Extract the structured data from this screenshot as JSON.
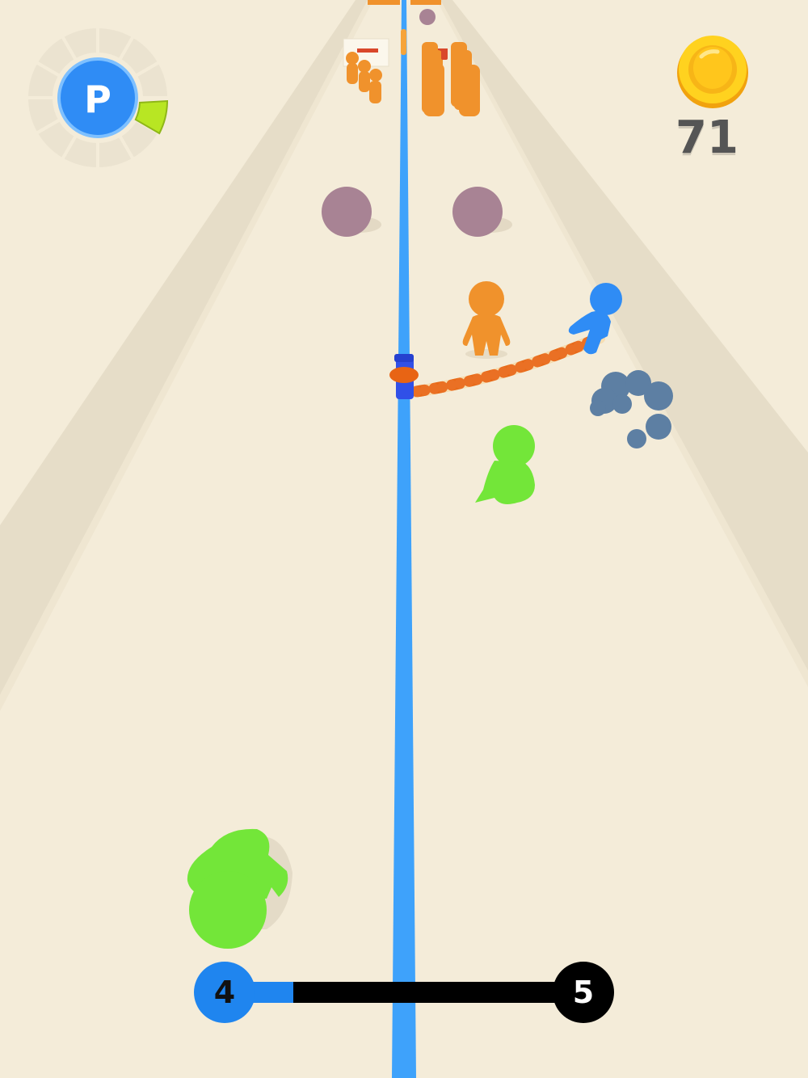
{
  "hud": {
    "power_badge_letter": "P",
    "power_meter_segments_total": 12,
    "power_meter_segments_filled": 1,
    "coin_count": "71"
  },
  "level_progress": {
    "current_level": "4",
    "next_level": "5",
    "progress_fraction": 0.15
  },
  "colors": {
    "ground": "#f4ecd9",
    "wall": "#e5dcc8",
    "track_line": "#3ea2fb",
    "player": "#2f8cf5",
    "enemy_orange": "#f0922c",
    "enemy_green": "#73e639",
    "boulder": "#a88394",
    "coin": "#f9b818",
    "progress_bar": "#000000",
    "accent_green": "#b8e623"
  }
}
